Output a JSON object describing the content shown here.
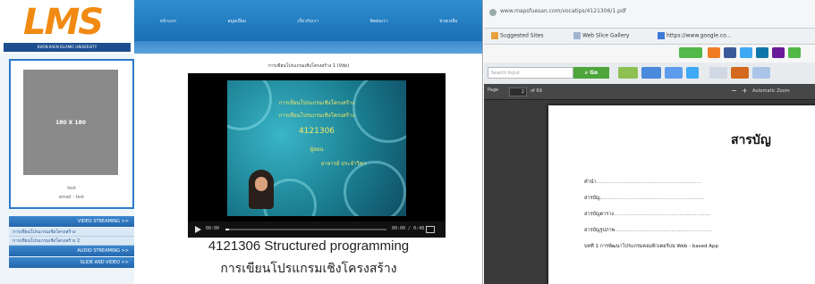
{
  "lms": {
    "logo_text": "LMS",
    "logo_sub": "KHON KAEN ISLAMIC UNIVERSITY",
    "nav": [
      "หน้าแรก",
      "สมุดเยี่ยม",
      "เกี่ยวกับเรา",
      "ติดต่อเรา",
      "ช่วยเหลือ"
    ],
    "profile": {
      "photo_placeholder": "180 X 180",
      "name": "test",
      "id": "email : test"
    },
    "side_menu": {
      "video_header": "VIDEO STREAMING >>",
      "video_items": [
        "การเขียนโปรแกรมเชิงโครงสร้าง",
        "การเขียนโปรแกรมเชิงโครงสร้าง 2"
      ],
      "audio_header": "AUDIO STREAMING >>",
      "slide_header": "SLIDE AND VIDEO >>"
    },
    "video_title": "การเขียนโปรแกรมเชิงโครงสร้าง 1 (Vdo)",
    "slide_lines": [
      "การเขียนโปรแกรมเชิงโครงสร้าง",
      "การเขียนโปรแกรมเชิงโครงสร้าง",
      "4121306",
      "ผู้สอน",
      "อาจารย์ ประจำวิชา"
    ],
    "player": {
      "current_time": "00:00",
      "total_time": "00:00 / 0:48",
      "progress": 0.02
    },
    "course_code": "4121306 Structured programming",
    "course_name": "การเขียนโปรแกรมเชิงโครงสร้าง"
  },
  "browser": {
    "url": "www.mapsfuesan.com/vocatips/4121306/1.pdf",
    "bookmarks": [
      "Suggested Sites",
      "Web Slice Gallery",
      "https://www.google.co..."
    ],
    "search_placeholder": "Search Input",
    "go_label": "Go",
    "pdf": {
      "page_label": "Page",
      "page_value": "2",
      "page_total": "of 69",
      "zoom": "Automatic Zoom",
      "minus": "−",
      "plus": "+"
    },
    "doc_title": "สารบัญ",
    "toc": [
      "คำนำ",
      "สารบัญ",
      "สารบัญตาราง",
      "สารบัญรูปภาพ",
      "บทที่ 1 การพัฒนาโปรแกรมคอมพิวเตอร์บน Web - based App"
    ]
  },
  "colors": {
    "lms_blue": "#1b6fb5",
    "logo_orange": "#f08a12",
    "go_green": "#4da53b"
  }
}
